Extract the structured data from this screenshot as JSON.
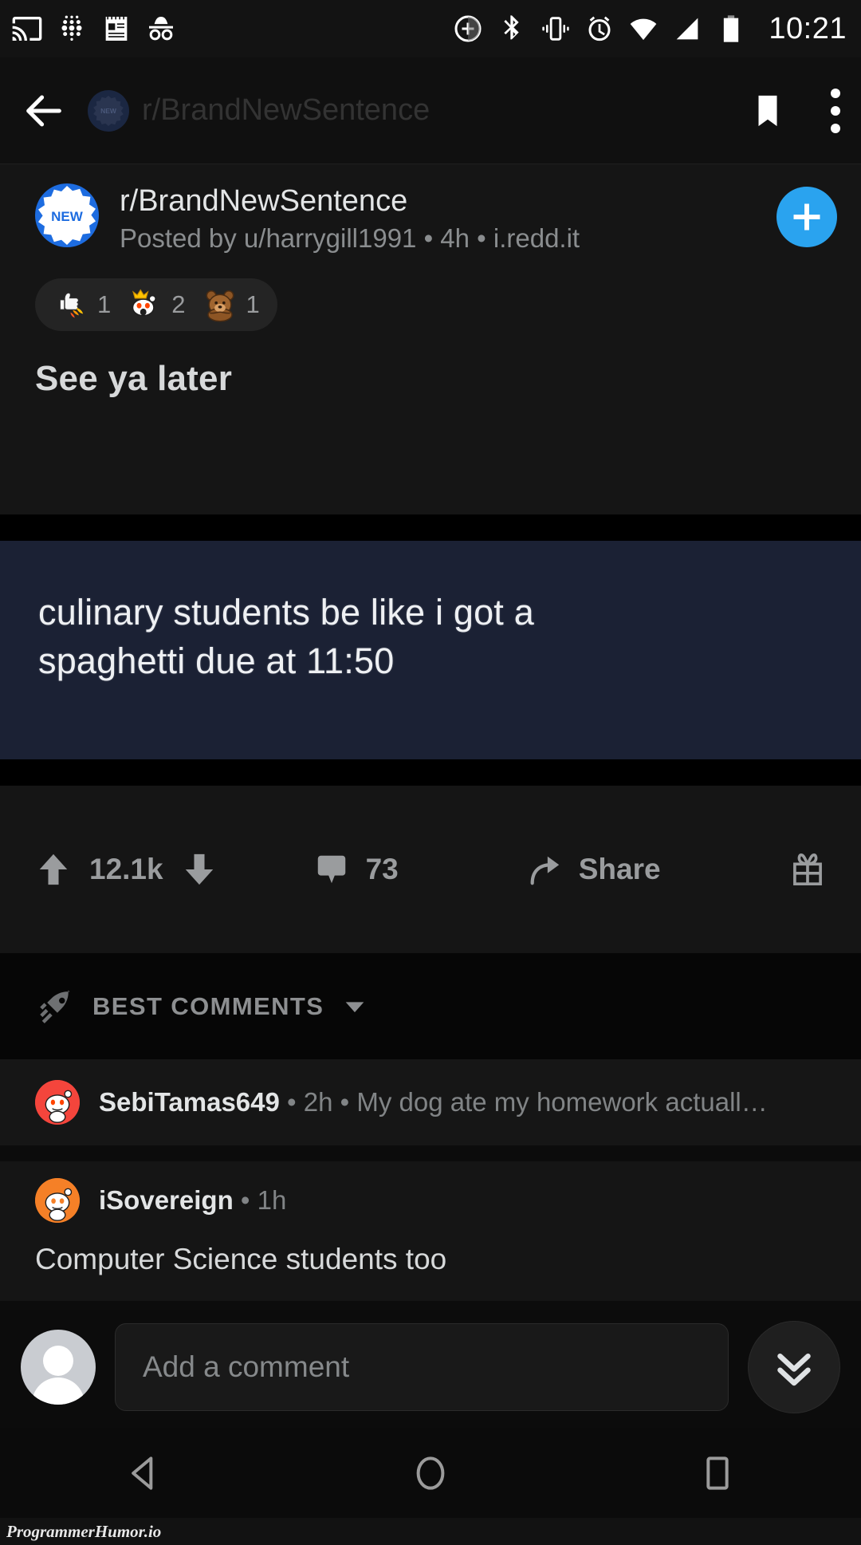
{
  "status_bar": {
    "time": "10:21",
    "left_icons": [
      "cast-icon",
      "dots-grid-icon",
      "notepad-icon",
      "incognito-icon"
    ],
    "right_icons": [
      "data-saver-icon",
      "bluetooth-icon",
      "vibrate-icon",
      "alarm-icon",
      "wifi-icon",
      "cell-signal-icon",
      "battery-icon"
    ]
  },
  "app_bar": {
    "back_label": "back-arrow-icon",
    "title": "r/BrandNewSentence",
    "save_icon": "bookmark-icon",
    "overflow_icon": "more-vertical-icon"
  },
  "post": {
    "subreddit": "r/BrandNewSentence",
    "avatar_badge": "NEW",
    "meta": "Posted by u/harrygill1991 • 4h • i.redd.it",
    "join_label": "+",
    "awards": [
      {
        "name": "rocket-like-award",
        "count": "1"
      },
      {
        "name": "crown-snoo-award",
        "count": "2"
      },
      {
        "name": "bear-hug-award",
        "count": "1"
      }
    ],
    "title": "See ya later",
    "media": {
      "alt": "meme-screenshot",
      "line1": "culinary students be like i got a",
      "line2": "spaghetti due at 11:50",
      "background_color": "#1b2134"
    },
    "actions": {
      "upvote_icon": "upvote-arrow-icon",
      "score": "12.1k",
      "downvote_icon": "downvote-arrow-icon",
      "comment_icon": "comment-bubble-icon",
      "comment_count": "73",
      "share_icon": "share-arrow-icon",
      "share_label": "Share",
      "award_icon": "gift-award-icon"
    }
  },
  "sort_bar": {
    "icon": "rocket-icon",
    "label": "BEST COMMENTS",
    "chevron": "chevron-down-icon"
  },
  "comments": [
    {
      "author": "SebiTamas649",
      "time": "2h",
      "preview": "My dog ate my homework actuall…",
      "collapsed": true,
      "avatar_color": "#f4453c"
    },
    {
      "author": "iSovereign",
      "time": "1h",
      "body": "Computer Science students too",
      "collapsed": false,
      "avatar_color": "#f58027"
    }
  ],
  "compose": {
    "avatar": "default-user-avatar",
    "placeholder": "Add a comment",
    "next_comment_icon": "double-chevron-down-icon"
  },
  "nav_bar": {
    "back": "nav-back-triangle-icon",
    "home": "nav-home-circle-icon",
    "recents": "nav-recents-square-icon"
  },
  "watermark": "ProgrammerHumor.io",
  "theme": {
    "accent_blue": "#2aa3ef",
    "card_bg": "#151515",
    "page_bg": "#0c0c0c"
  }
}
